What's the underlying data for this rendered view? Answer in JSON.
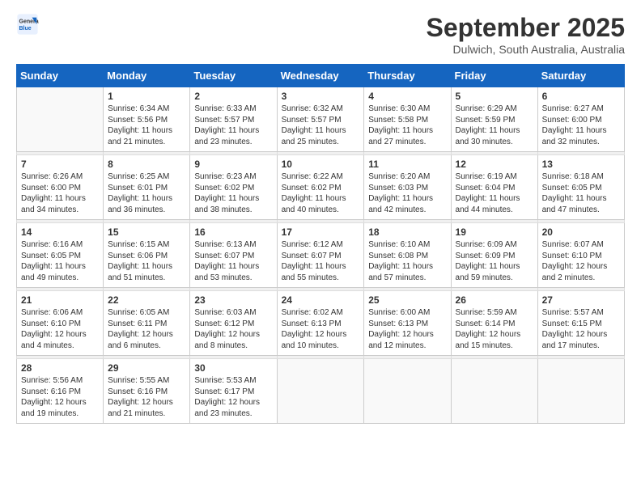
{
  "header": {
    "logo": {
      "line1": "General",
      "line2": "Blue"
    },
    "title": "September 2025",
    "location": "Dulwich, South Australia, Australia"
  },
  "days_of_week": [
    "Sunday",
    "Monday",
    "Tuesday",
    "Wednesday",
    "Thursday",
    "Friday",
    "Saturday"
  ],
  "weeks": [
    [
      {
        "day": "",
        "text": ""
      },
      {
        "day": "1",
        "text": "Sunrise: 6:34 AM\nSunset: 5:56 PM\nDaylight: 11 hours\nand 21 minutes."
      },
      {
        "day": "2",
        "text": "Sunrise: 6:33 AM\nSunset: 5:57 PM\nDaylight: 11 hours\nand 23 minutes."
      },
      {
        "day": "3",
        "text": "Sunrise: 6:32 AM\nSunset: 5:57 PM\nDaylight: 11 hours\nand 25 minutes."
      },
      {
        "day": "4",
        "text": "Sunrise: 6:30 AM\nSunset: 5:58 PM\nDaylight: 11 hours\nand 27 minutes."
      },
      {
        "day": "5",
        "text": "Sunrise: 6:29 AM\nSunset: 5:59 PM\nDaylight: 11 hours\nand 30 minutes."
      },
      {
        "day": "6",
        "text": "Sunrise: 6:27 AM\nSunset: 6:00 PM\nDaylight: 11 hours\nand 32 minutes."
      }
    ],
    [
      {
        "day": "7",
        "text": "Sunrise: 6:26 AM\nSunset: 6:00 PM\nDaylight: 11 hours\nand 34 minutes."
      },
      {
        "day": "8",
        "text": "Sunrise: 6:25 AM\nSunset: 6:01 PM\nDaylight: 11 hours\nand 36 minutes."
      },
      {
        "day": "9",
        "text": "Sunrise: 6:23 AM\nSunset: 6:02 PM\nDaylight: 11 hours\nand 38 minutes."
      },
      {
        "day": "10",
        "text": "Sunrise: 6:22 AM\nSunset: 6:02 PM\nDaylight: 11 hours\nand 40 minutes."
      },
      {
        "day": "11",
        "text": "Sunrise: 6:20 AM\nSunset: 6:03 PM\nDaylight: 11 hours\nand 42 minutes."
      },
      {
        "day": "12",
        "text": "Sunrise: 6:19 AM\nSunset: 6:04 PM\nDaylight: 11 hours\nand 44 minutes."
      },
      {
        "day": "13",
        "text": "Sunrise: 6:18 AM\nSunset: 6:05 PM\nDaylight: 11 hours\nand 47 minutes."
      }
    ],
    [
      {
        "day": "14",
        "text": "Sunrise: 6:16 AM\nSunset: 6:05 PM\nDaylight: 11 hours\nand 49 minutes."
      },
      {
        "day": "15",
        "text": "Sunrise: 6:15 AM\nSunset: 6:06 PM\nDaylight: 11 hours\nand 51 minutes."
      },
      {
        "day": "16",
        "text": "Sunrise: 6:13 AM\nSunset: 6:07 PM\nDaylight: 11 hours\nand 53 minutes."
      },
      {
        "day": "17",
        "text": "Sunrise: 6:12 AM\nSunset: 6:07 PM\nDaylight: 11 hours\nand 55 minutes."
      },
      {
        "day": "18",
        "text": "Sunrise: 6:10 AM\nSunset: 6:08 PM\nDaylight: 11 hours\nand 57 minutes."
      },
      {
        "day": "19",
        "text": "Sunrise: 6:09 AM\nSunset: 6:09 PM\nDaylight: 11 hours\nand 59 minutes."
      },
      {
        "day": "20",
        "text": "Sunrise: 6:07 AM\nSunset: 6:10 PM\nDaylight: 12 hours\nand 2 minutes."
      }
    ],
    [
      {
        "day": "21",
        "text": "Sunrise: 6:06 AM\nSunset: 6:10 PM\nDaylight: 12 hours\nand 4 minutes."
      },
      {
        "day": "22",
        "text": "Sunrise: 6:05 AM\nSunset: 6:11 PM\nDaylight: 12 hours\nand 6 minutes."
      },
      {
        "day": "23",
        "text": "Sunrise: 6:03 AM\nSunset: 6:12 PM\nDaylight: 12 hours\nand 8 minutes."
      },
      {
        "day": "24",
        "text": "Sunrise: 6:02 AM\nSunset: 6:13 PM\nDaylight: 12 hours\nand 10 minutes."
      },
      {
        "day": "25",
        "text": "Sunrise: 6:00 AM\nSunset: 6:13 PM\nDaylight: 12 hours\nand 12 minutes."
      },
      {
        "day": "26",
        "text": "Sunrise: 5:59 AM\nSunset: 6:14 PM\nDaylight: 12 hours\nand 15 minutes."
      },
      {
        "day": "27",
        "text": "Sunrise: 5:57 AM\nSunset: 6:15 PM\nDaylight: 12 hours\nand 17 minutes."
      }
    ],
    [
      {
        "day": "28",
        "text": "Sunrise: 5:56 AM\nSunset: 6:16 PM\nDaylight: 12 hours\nand 19 minutes."
      },
      {
        "day": "29",
        "text": "Sunrise: 5:55 AM\nSunset: 6:16 PM\nDaylight: 12 hours\nand 21 minutes."
      },
      {
        "day": "30",
        "text": "Sunrise: 5:53 AM\nSunset: 6:17 PM\nDaylight: 12 hours\nand 23 minutes."
      },
      {
        "day": "",
        "text": ""
      },
      {
        "day": "",
        "text": ""
      },
      {
        "day": "",
        "text": ""
      },
      {
        "day": "",
        "text": ""
      }
    ]
  ]
}
